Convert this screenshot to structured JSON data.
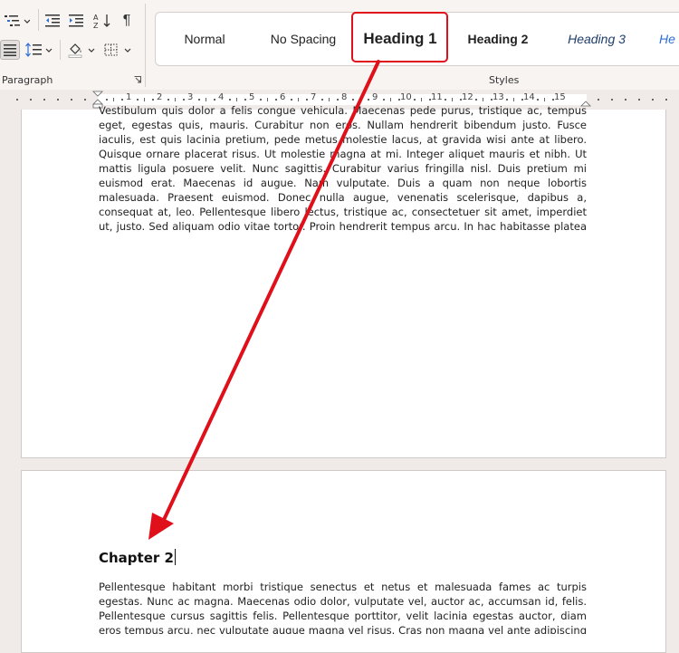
{
  "ribbon": {
    "paragraph_group_label": "Paragraph",
    "styles_group_label": "Styles",
    "styles": [
      {
        "name": "Normal"
      },
      {
        "name": "No Spacing"
      },
      {
        "name": "Heading 1"
      },
      {
        "name": "Heading 2"
      },
      {
        "name": "Heading 3"
      },
      {
        "name": "He"
      }
    ],
    "pilcrow": "¶"
  },
  "ruler": {
    "numbers": [
      "1",
      "2",
      "3",
      "4",
      "5",
      "6",
      "7",
      "8",
      "9",
      "10",
      "11",
      "12",
      "13",
      "14",
      "15"
    ]
  },
  "page1": {
    "text": "Vestibulum quis dolor a felis congue vehicula. Maecenas pede purus, tristique ac, tempus eget, egestas quis, mauris. Curabitur non eros. Nullam hendrerit bibendum justo. Fusce iaculis, est quis lacinia pretium, pede metus molestie lacus, at gravida wisi ante at libero. Quisque ornare placerat risus. Ut molestie magna at mi. Integer aliquet mauris et nibh. Ut mattis ligula posuere velit. Nunc sagittis. Curabitur varius fringilla nisl. Duis pretium mi euismod erat. Maecenas id augue. Nam vulputate. Duis a quam non neque lobortis malesuada. Praesent euismod. Donec nulla augue, venenatis scelerisque, dapibus a, consequat at, leo. Pellentesque libero lectus, tristique ac, consectetuer sit amet, imperdiet ut, justo. Sed aliquam odio vitae tortor. Proin hendrerit tempus arcu. In hac habitasse platea dictumst."
  },
  "page2": {
    "heading": "Chapter 2",
    "text": "Pellentesque habitant morbi tristique senectus et netus et malesuada fames ac turpis egestas. Nunc ac magna. Maecenas odio dolor, vulputate vel, auctor ac, accumsan id, felis. Pellentesque cursus sagittis felis. Pellentesque porttitor, velit lacinia egestas auctor, diam eros tempus arcu, nec vulputate augue magna vel risus. Cras non magna vel ante adipiscing rhoncus. Vivamus a mi."
  },
  "colors": {
    "annotation_red": "#e0101a"
  }
}
